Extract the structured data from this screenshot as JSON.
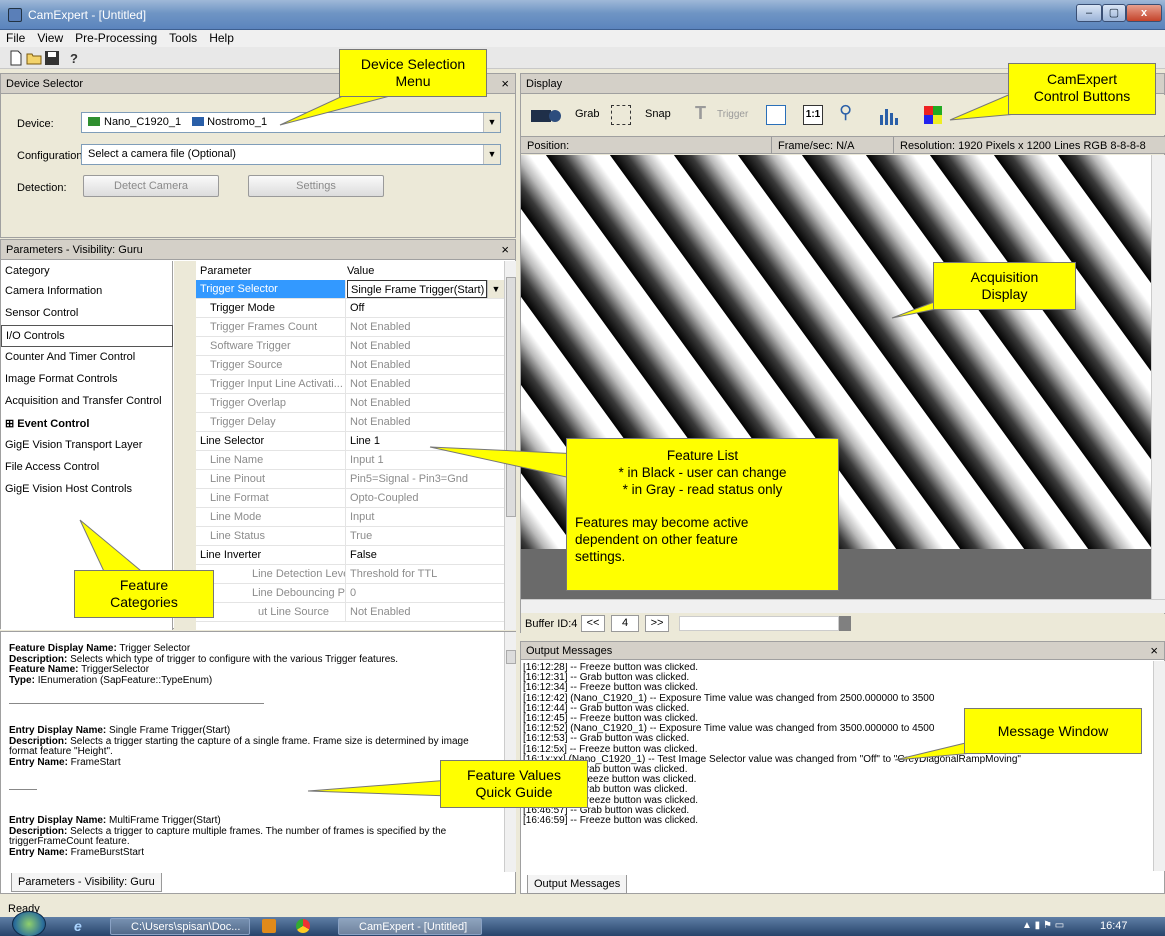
{
  "window": {
    "title": "CamExpert - [Untitled]",
    "minimize": "–",
    "maximize": "▢",
    "close": "x"
  },
  "menu": [
    "File",
    "View",
    "Pre-Processing",
    "Tools",
    "Help"
  ],
  "device_selector": {
    "title": "Device Selector",
    "close": "×",
    "device_label": "Device:",
    "device_value": "Nano_C1920_1",
    "device_value2": "Nostromo_1",
    "config_label": "Configuration:",
    "config_value": "Select a camera file (Optional)",
    "detection_label": "Detection:",
    "detect_button": "Detect Camera",
    "settings_button": "Settings"
  },
  "parameters": {
    "title": "Parameters - Visibility: Guru",
    "close": "×",
    "col_category": "Category",
    "col_parameter": "Parameter",
    "col_value": "Value",
    "categories": [
      "Camera Information",
      "Sensor Control",
      "I/O Controls",
      "Counter And Timer Control",
      "Image Format Controls",
      "Acquisition and Transfer Control",
      "Event Control",
      "GigE Vision Transport Layer",
      "File Access Control",
      "GigE Vision Host Controls"
    ],
    "event_expander": "⊞",
    "rows": [
      {
        "name": "Trigger Selector",
        "value": "Single Frame Trigger(Start)"
      },
      {
        "name": "Trigger Mode",
        "value": "Off"
      },
      {
        "name": "Trigger Frames Count",
        "value": "Not Enabled"
      },
      {
        "name": "Software Trigger",
        "value": "Not Enabled"
      },
      {
        "name": "Trigger Source",
        "value": "Not Enabled"
      },
      {
        "name": "Trigger Input Line Activati...",
        "value": "Not Enabled"
      },
      {
        "name": "Trigger Overlap",
        "value": "Not Enabled"
      },
      {
        "name": "Trigger Delay",
        "value": "Not Enabled"
      },
      {
        "name": "Line Selector",
        "value": "Line 1"
      },
      {
        "name": "Line Name",
        "value": "Input 1"
      },
      {
        "name": "Line Pinout",
        "value": "Pin5=Signal - Pin3=Gnd"
      },
      {
        "name": "Line Format",
        "value": "Opto-Coupled"
      },
      {
        "name": "Line Mode",
        "value": "Input"
      },
      {
        "name": "Line Status",
        "value": "True"
      },
      {
        "name": "Line Inverter",
        "value": "False"
      },
      {
        "name": "Line Detection Level",
        "value": "Threshold for TTL"
      },
      {
        "name": "Line Debouncing Pe...",
        "value": "0"
      },
      {
        "name": "ut Line Source",
        "value": "Not Enabled"
      }
    ],
    "bottom_tab": "Parameters - Visibility: Guru"
  },
  "quick_guide": {
    "b1_l1_k": "Feature Display Name:",
    "b1_l1_v": " Trigger Selector",
    "b1_l2_k": "Description:",
    "b1_l2_v": " Selects which type of trigger to configure with the various Trigger features.",
    "b1_l3_k": "Feature Name:",
    "b1_l3_v": " TriggerSelector",
    "b1_l4_k": "Type:",
    "b1_l4_v": " IEnumeration (SapFeature::TypeEnum)",
    "b2_l1_k": "Entry Display Name:",
    "b2_l1_v": " Single Frame Trigger(Start)",
    "b2_l2_k": "Description:",
    "b2_l2_v": " Selects a trigger starting the capture of a single frame. Frame size is determined by image",
    "b2_l3": "format feature \"Height\".",
    "b2_l4_k": "Entry Name:",
    "b2_l4_v": " FrameStart",
    "b3_l1_k": "Entry Display Name:",
    "b3_l1_v": " MultiFrame Trigger(Start)",
    "b3_l2_k": "Description:",
    "b3_l2_v": " Selects a trigger to capture multiple frames. The number of frames is specified by the",
    "b3_l3": "triggerFrameCount feature.",
    "b3_l4_k": "Entry Name:",
    "b3_l4_v": " FrameBurstStart"
  },
  "display": {
    "title": "Display",
    "close": "×",
    "grab": "Grab",
    "snap": "Snap",
    "trigger": "Trigger",
    "one_to_one": "1:1",
    "position_label": "Position:",
    "fps_label": "Frame/sec: N/A",
    "resolution_label": "Resolution: 1920 Pixels x 1200 Lines  RGB 8-8-8-8",
    "buffer_label": "Buffer ID:4",
    "prev": "<<",
    "buffer_value": "4",
    "next": ">>"
  },
  "output": {
    "title": "Output Messages",
    "close": "×",
    "tab": "Output Messages",
    "lines": [
      "[16:12:28] -- Freeze button was clicked.",
      "[16:12:31] -- Grab button was clicked.",
      "[16:12:34] -- Freeze button was clicked.",
      "[16:12:42] (Nano_C1920_1)  -- Exposure Time value was changed from 2500.000000 to 3500",
      "[16:12:44] -- Grab button was clicked.",
      "[16:12:45] -- Freeze button was clicked.",
      "[16:12:52] (Nano_C1920_1)  -- Exposure Time value was changed from 3500.000000 to 4500",
      "[16:12:53] -- Grab button was clicked.",
      "[16:12:5x] -- Freeze button was clicked.",
      "[16:1x:xx] (Nano_C1920_1)  -- Test Image Selector value was changed from \"Off\" to \"GreyDiagonalRampMoving\"",
      "[16:1x:xx] -- Grab button was clicked.",
      "[16:1x:xx] -- Freeze button was clicked.",
      "[16:1x:xx] -- Grab button was clicked.",
      "[16:46:52] -- Freeze button was clicked.",
      "[16:46:57] -- Grab button was clicked.",
      "[16:46:59] -- Freeze button was clicked."
    ]
  },
  "callouts": {
    "device_menu_l1": "Device Selection",
    "device_menu_l2": "Menu",
    "control_l1": "CamExpert",
    "control_l2": "Control Buttons",
    "acq_l1": "Acquisition",
    "acq_l2": "Display",
    "fl_l1": "Feature List",
    "fl_l2": "* in Black - user can change",
    "fl_l3": "* in Gray - read status only",
    "fl_l4": "Features may become active",
    "fl_l5": "dependent on other feature",
    "fl_l6": "settings.",
    "cat_l1": "Feature",
    "cat_l2": "Categories",
    "msg_l1": "Message Window",
    "qg_l1": "Feature Values",
    "qg_l2": "Quick Guide"
  },
  "status_bar": {
    "text": "Ready"
  },
  "taskbar": {
    "item1": "C:\\Users\\spisan\\Doc...",
    "item2": "CamExpert - [Untitled]",
    "clock": "16:47"
  },
  "colors": {
    "callout": "#ffff00",
    "selection": "#3399ff",
    "panel_header": "#d4d0c8"
  }
}
